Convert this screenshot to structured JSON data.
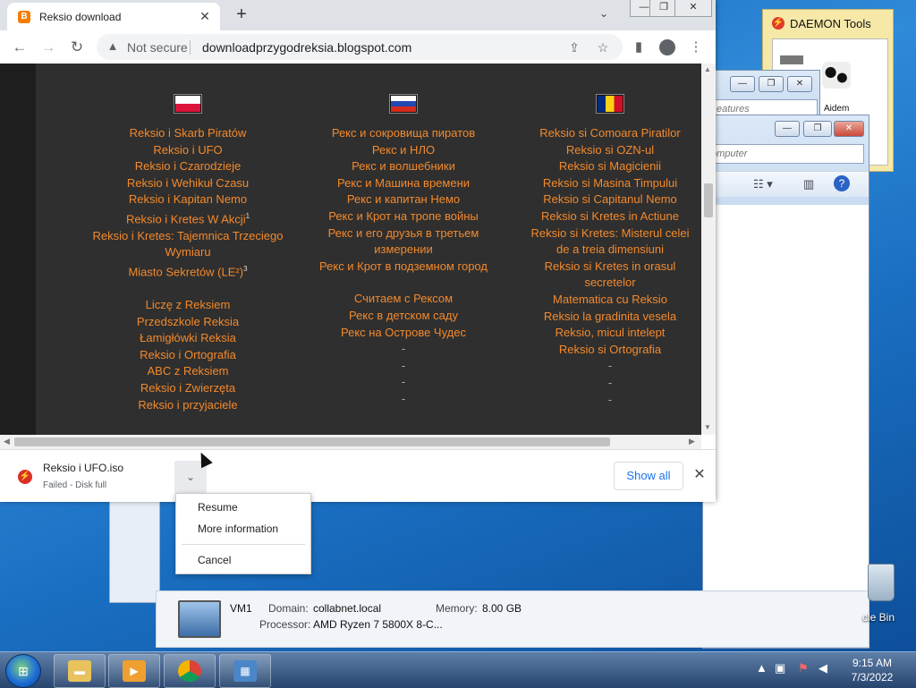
{
  "browser": {
    "tab_title": "Reksio download",
    "tab_close": "✕",
    "new_tab": "+",
    "tab_search": "⌄",
    "window_controls": {
      "minimize": "—",
      "restore": "❐",
      "close": "✕"
    },
    "nav": {
      "back": "←",
      "forward": "→",
      "reload": "↻"
    },
    "security_label": "Not secure",
    "url": "downloadprzygodreksia.blogspot.com",
    "icons": {
      "share": "⇪",
      "bookmark": "☆",
      "sidepanel": "▮",
      "profile": "●",
      "menu": "⋮"
    }
  },
  "page": {
    "columns": [
      {
        "flag": "pl",
        "items": [
          {
            "t": "Reksio i Skarb Piratów"
          },
          {
            "t": "Reksio i UFO"
          },
          {
            "t": "Reksio i Czarodzieje"
          },
          {
            "t": "Reksio i Wehikuł Czasu"
          },
          {
            "t": "Reksio i Kapitan Nemo"
          },
          {
            "t": "Reksio i Kretes W Akcji",
            "sup": "1"
          },
          {
            "t": "Reksio i Kretes: Tajemnica Trzeciego"
          },
          {
            "t": "Wymiaru"
          },
          {
            "t": "Miasto Sekretów (LE²)",
            "sup": "3"
          },
          {
            "gap": true
          },
          {
            "t": "Liczę z Reksiem"
          },
          {
            "t": "Przedszkole Reksia"
          },
          {
            "t": "Łamigłówki Reksia"
          },
          {
            "t": "Reksio i Ortografia"
          },
          {
            "t": "ABC z Reksiem"
          },
          {
            "t": "Reksio i Zwierzęta"
          },
          {
            "t": "Reksio i przyjaciele"
          }
        ]
      },
      {
        "flag": "ru",
        "items": [
          {
            "t": "Рекс и сокровища пиратов"
          },
          {
            "t": "Рекс и НЛО"
          },
          {
            "t": "Рекс и волшебники"
          },
          {
            "t": "Рекс и Машина времени"
          },
          {
            "t": "Рекс и капитан Немо"
          },
          {
            "t": "Рекс и Крот на тропе войны"
          },
          {
            "t": "Рекс и его друзья в третьем"
          },
          {
            "t": "измерении"
          },
          {
            "t": "Рекс и Крот в подземном город"
          },
          {
            "gap": true
          },
          {
            "t": "Считаем с Рексом"
          },
          {
            "t": "Рекс в детском саду"
          },
          {
            "t": "Рекс на Острове Чудес"
          },
          {
            "t": "-",
            "dash": true
          },
          {
            "t": "-",
            "dash": true
          },
          {
            "t": "-",
            "dash": true
          },
          {
            "t": "-",
            "dash": true
          }
        ]
      },
      {
        "flag": "ro",
        "items": [
          {
            "t": "Reksio si Comoara Piratilor"
          },
          {
            "t": "Reksio si OZN-ul"
          },
          {
            "t": "Reksio si Magicienii"
          },
          {
            "t": "Reksio si Masina Timpului"
          },
          {
            "t": "Reksio si Capitanul Nemo"
          },
          {
            "t": "Reksio si Kretes in Actiune"
          },
          {
            "t": "Reksio si Kretes: Misterul celei"
          },
          {
            "t": "de a treia dimensiuni"
          },
          {
            "t": "Reksio si Kretes in orasul"
          },
          {
            "t": "secretelor"
          },
          {
            "t": "Matematica cu Reksio"
          },
          {
            "t": "Reksio la gradinita vesela"
          },
          {
            "t": "Reksio, micul intelept"
          },
          {
            "t": "Reksio si Ortografia"
          },
          {
            "t": "-",
            "dash": true
          },
          {
            "t": "-",
            "dash": true
          },
          {
            "t": "-",
            "dash": true
          }
        ]
      }
    ]
  },
  "download": {
    "filename": "Reksio i UFO.iso",
    "status": "Failed - Disk full",
    "chevron": "⌄",
    "show_all": "Show all",
    "close": "✕",
    "menu": [
      "Resume",
      "More information",
      "Cancel"
    ]
  },
  "desktop": {
    "daemon_title": "DAEMON Tools",
    "daemon_item": "Aidem",
    "explorer_search_hint_1": "eatures",
    "explorer_search_hint_2": "omputer",
    "vm": {
      "name": "VM1",
      "domain_label": "Domain:",
      "domain": "collabnet.local",
      "memory_label": "Memory:",
      "memory": "8.00 GB",
      "processor_label": "Processor:",
      "processor": "AMD Ryzen 7 5800X 8-C..."
    },
    "recycle_label": "cle Bin"
  },
  "taskbar": {
    "time": "9:15 AM",
    "date": "7/3/2022"
  }
}
